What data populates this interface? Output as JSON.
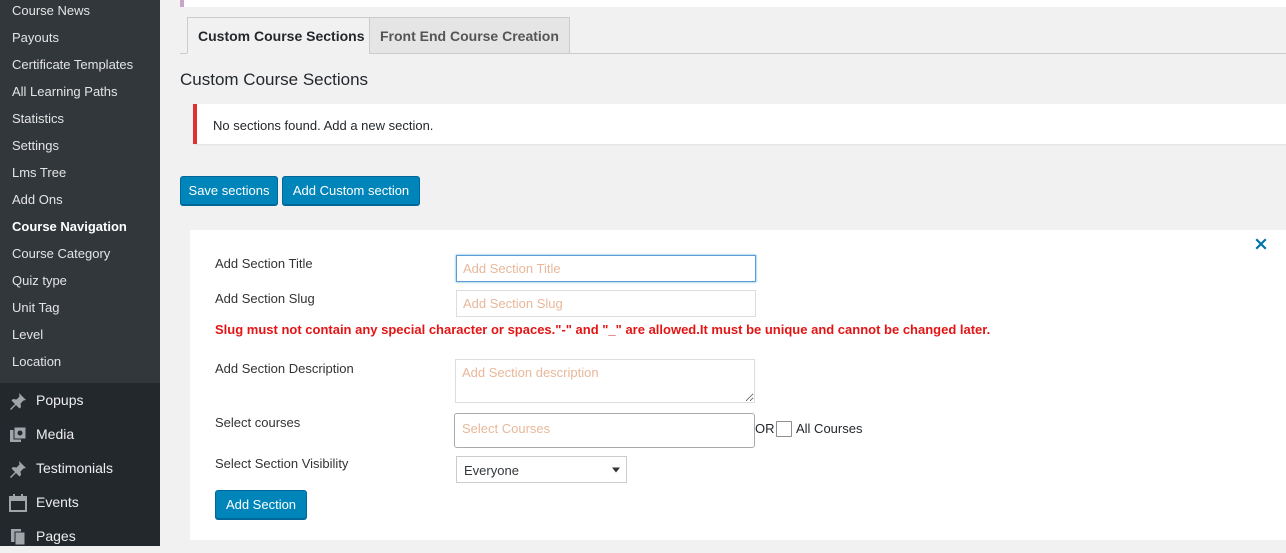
{
  "sidebar": {
    "submenu": [
      {
        "label": "Course News",
        "current": false
      },
      {
        "label": "Payouts",
        "current": false
      },
      {
        "label": "Certificate Templates",
        "current": false
      },
      {
        "label": "All Learning Paths",
        "current": false
      },
      {
        "label": "Statistics",
        "current": false
      },
      {
        "label": "Settings",
        "current": false
      },
      {
        "label": "Lms Tree",
        "current": false
      },
      {
        "label": "Add Ons",
        "current": false
      },
      {
        "label": "Course Navigation",
        "current": true
      },
      {
        "label": "Course Category",
        "current": false
      },
      {
        "label": "Quiz type",
        "current": false
      },
      {
        "label": "Unit Tag",
        "current": false
      },
      {
        "label": "Level",
        "current": false
      },
      {
        "label": "Location",
        "current": false
      }
    ],
    "menu": [
      {
        "label": "Popups",
        "icon": "pin-icon"
      },
      {
        "label": "Media",
        "icon": "media-icon"
      },
      {
        "label": "Testimonials",
        "icon": "pin-icon"
      },
      {
        "label": "Events",
        "icon": "calendar-icon"
      },
      {
        "label": "Pages",
        "icon": "pages-icon"
      }
    ]
  },
  "tabs": [
    {
      "label": "Custom Course Sections",
      "active": true
    },
    {
      "label": "Front End Course Creation",
      "active": false
    }
  ],
  "page_title": "Custom Course Sections",
  "notice": {
    "text": "No sections found. Add a new section."
  },
  "buttons": {
    "save_sections": "Save sections",
    "add_custom_section": "Add Custom section"
  },
  "form": {
    "title_label": "Add Section Title",
    "title_placeholder": "Add Section Title",
    "slug_label": "Add Section Slug",
    "slug_placeholder": "Add Section Slug",
    "slug_warning": "Slug must not contain any special character or spaces.\"-\" and \"_\" are allowed.It must be unique and cannot be changed later.",
    "description_label": "Add Section Description",
    "description_placeholder": "Add Section description",
    "courses_label": "Select courses",
    "courses_placeholder": "Select Courses",
    "or_text": "OR",
    "all_courses_label": "All Courses",
    "visibility_label": "Select Section Visibility",
    "visibility_value": "Everyone",
    "add_section_button": "Add Section"
  },
  "colors": {
    "primary_button": "#0085ba",
    "error_border": "#dc3232",
    "warning_text": "#e41414",
    "sidebar_bg": "#23282d",
    "submenu_bg": "#32373c"
  }
}
